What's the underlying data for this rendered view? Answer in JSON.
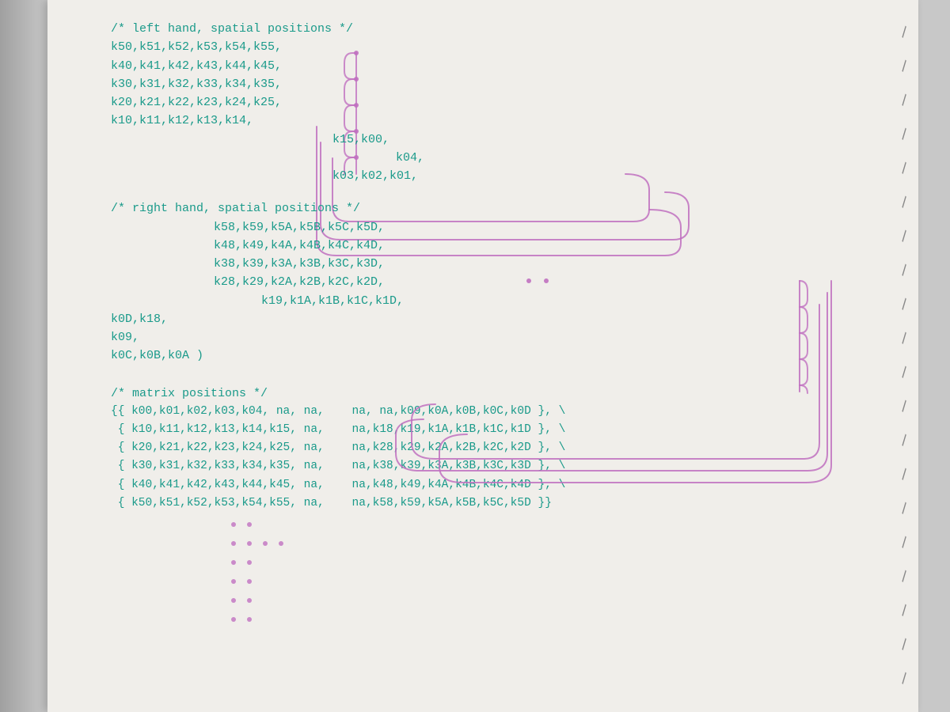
{
  "page": {
    "background": "#c8c8c8",
    "paper_bg": "#f0eeea"
  },
  "left_hand": {
    "comment": "/* left hand, spatial positions */",
    "rows": [
      "k50,k51,k52,k53,k54,k55,",
      "k40,k41,k42,k43,k44,k45,",
      "k30,k31,k32,k33,k34,k35,",
      "k20,k21,k22,k23,k24,k25,",
      "k10,k11,k12,k13,k14,",
      "                              k15,k00,",
      "                                  k04,",
      "                              k03,k02,k01,"
    ]
  },
  "right_hand": {
    "comment": "/* right hand, spatial positions */",
    "rows": [
      "        k58,k59,k5A,k5B,k5C,k5D,",
      "        k48,k49,k4A,k4B,k4C,k4D,",
      "        k38,k39,k3A,k3B,k3C,k3D,",
      "        k28,k29,k2A,k2B,k2C,k2D,",
      "            k19,k1A,k1B,k1C,k1D,",
      "k0D,k18,",
      "k09,",
      "k0C,k0B,k0A )"
    ]
  },
  "matrix": {
    "comment": "/* matrix positions */",
    "rows": [
      "{{ k00,k01,k02,k03,k04, na, na,    na, na,k09,k0A,k0B,k0C,k0D },",
      " { k10,k11,k12,k13,k14,k15, na,    na,k18,k19,k1A,k1B,k1C,k1D },",
      " { k20,k21,k22,k23,k24,k25, na,    na,k28,k29,k2A,k2B,k2C,k2D },",
      " { k30,k31,k32,k33,k34,k35, na,    na,k38,k39,k3A,k3B,k3C,k3D },",
      " { k40,k41,k42,k43,k44,k45, na,    na,k48,k49,k4A,k4B,k4C,k4D },",
      " { k50,k51,k52,k53,k54,k55, na,    na,k58,k59,k5A,k5B,k5C,k5D }}"
    ]
  },
  "binding": {
    "marks": [
      "\\",
      "\\",
      "\\",
      "\\",
      "\\",
      "\\",
      "\\",
      "\\",
      "\\",
      "\\",
      "\\",
      "\\",
      "\\",
      "\\",
      "\\",
      "\\",
      "\\",
      "\\",
      "\\",
      "\\"
    ]
  }
}
